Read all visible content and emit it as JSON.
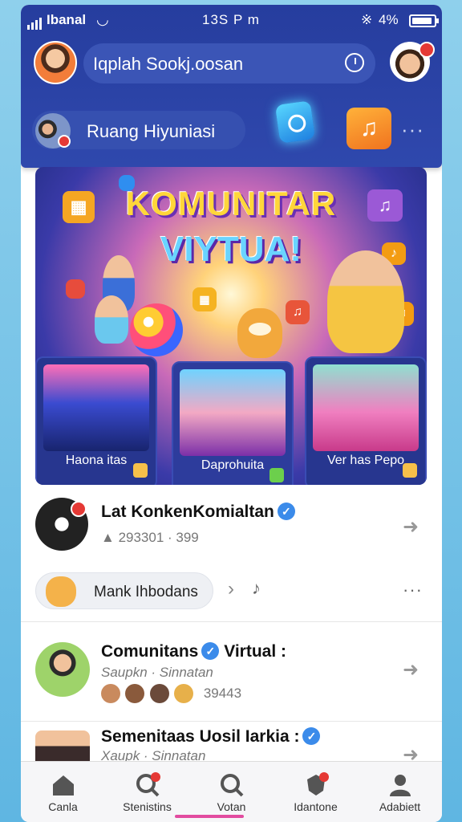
{
  "status_bar": {
    "carrier": "Ibanal",
    "time": "13S P m",
    "battery": "4%"
  },
  "header": {
    "search_text": "Iqplah Sookj.oosan",
    "room_label": "Ruang Hiyuniasi"
  },
  "hero": {
    "title_line1": "KOMUNITAR",
    "title_line2": "VIYTUA!",
    "cards": [
      {
        "label": "Haona itas"
      },
      {
        "label": "Daprohuita"
      },
      {
        "label": "Ver has Pepo"
      }
    ]
  },
  "feed": [
    {
      "title": "Lat KonkenKomialtan",
      "meta": "293301 · 399"
    },
    {
      "title": "Comunitans",
      "title_tail": "Virtual :",
      "meta": "Saupkn · Sinnatan",
      "meta2": "39443"
    },
    {
      "title": "Semenitaas",
      "title_tail": "Uosil Iarkia :",
      "meta": "Xaupk · Sinnatan"
    }
  ],
  "chip": {
    "label": "Mank Ihbodans"
  },
  "nav": [
    {
      "label": "Canla",
      "icon": "home-icon"
    },
    {
      "label": "Stenistins",
      "icon": "search-badge-icon"
    },
    {
      "label": "Votan",
      "icon": "search-icon"
    },
    {
      "label": "Idantone",
      "icon": "shield-badge-icon"
    },
    {
      "label": "Adabiett",
      "icon": "person-icon"
    }
  ],
  "colors": {
    "header": "#263d9e",
    "accent": "#3b8bea",
    "badge": "#e53935",
    "active": "#e24ca0"
  }
}
